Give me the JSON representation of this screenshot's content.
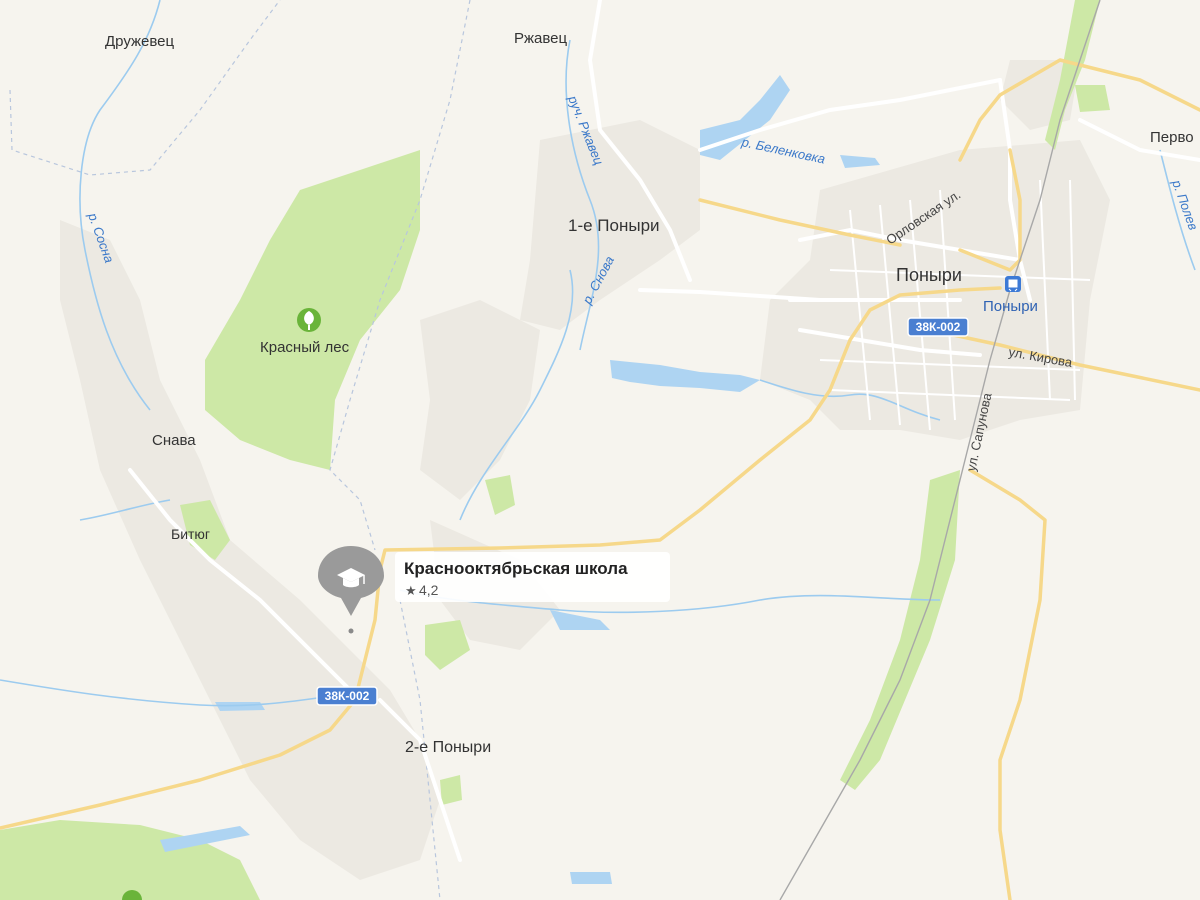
{
  "map": {
    "places": {
      "druzhevets": "Дружевец",
      "rzhavets": "Ржавец",
      "pervo": "Перво",
      "ponyri1": "1-е Поныри",
      "ponyri_town": "Поныри",
      "ponyri_station": "Поныри",
      "snava": "Снава",
      "bityug": "Битюг",
      "ponyri2": "2-е Поныри",
      "krasny_les": "Красный лес"
    },
    "water": {
      "sosna": "р. Сосна",
      "rzhavets_stream": "руч. Ржавец",
      "belenkovka": "р. Беленковка",
      "snova": "р. Снова",
      "polevaya": "р. Полев"
    },
    "streets": {
      "orlovskaya": "Орловская ул.",
      "kirova": "ул. Кирова",
      "sapunova": "ул. Сапунова"
    },
    "roads": {
      "shield_north": "38К-002",
      "shield_south": "38К-002"
    },
    "poi": {
      "name": "Краснооктябрьская школа",
      "rating": "4,2",
      "icon": "graduation-cap-icon"
    },
    "colors": {
      "land": "#f6f4ee",
      "forest": "#cde8a6",
      "water": "#aed4f2",
      "road_major": "#f6d88a",
      "poi_pin": "#9a9a9a",
      "shield": "#4a7fd1"
    }
  }
}
